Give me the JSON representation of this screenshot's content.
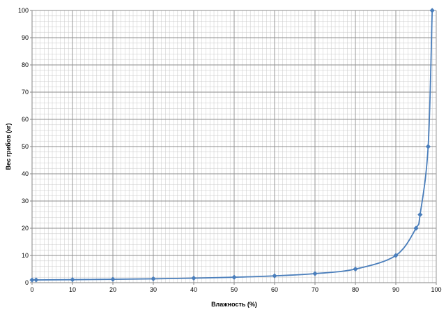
{
  "chart_data": {
    "type": "line",
    "title": "",
    "xlabel": "Влажность (%)",
    "ylabel": "Вес грибов (кг)",
    "xlim": [
      0,
      100
    ],
    "ylim": [
      0,
      100
    ],
    "x_ticks": [
      0,
      10,
      20,
      30,
      40,
      50,
      60,
      70,
      80,
      90,
      100
    ],
    "y_ticks": [
      0,
      10,
      20,
      30,
      40,
      50,
      60,
      70,
      80,
      90,
      100
    ],
    "grid": true,
    "legend": "none",
    "series": [
      {
        "x": [
          0,
          1,
          10,
          20,
          30,
          40,
          50,
          60,
          70,
          80,
          90,
          95,
          96,
          98,
          99
        ],
        "y": [
          1,
          1.01,
          1.11,
          1.25,
          1.43,
          1.67,
          2,
          2.5,
          3.33,
          5,
          10,
          20,
          25,
          50,
          100
        ],
        "color": "#4a7ebb"
      }
    ],
    "colors": {
      "series": "#4a7ebb",
      "marker": "#4a7ebb",
      "major_grid": "#8c8c8c",
      "minor_grid": "#c8c8c8",
      "axis": "#868686"
    }
  }
}
